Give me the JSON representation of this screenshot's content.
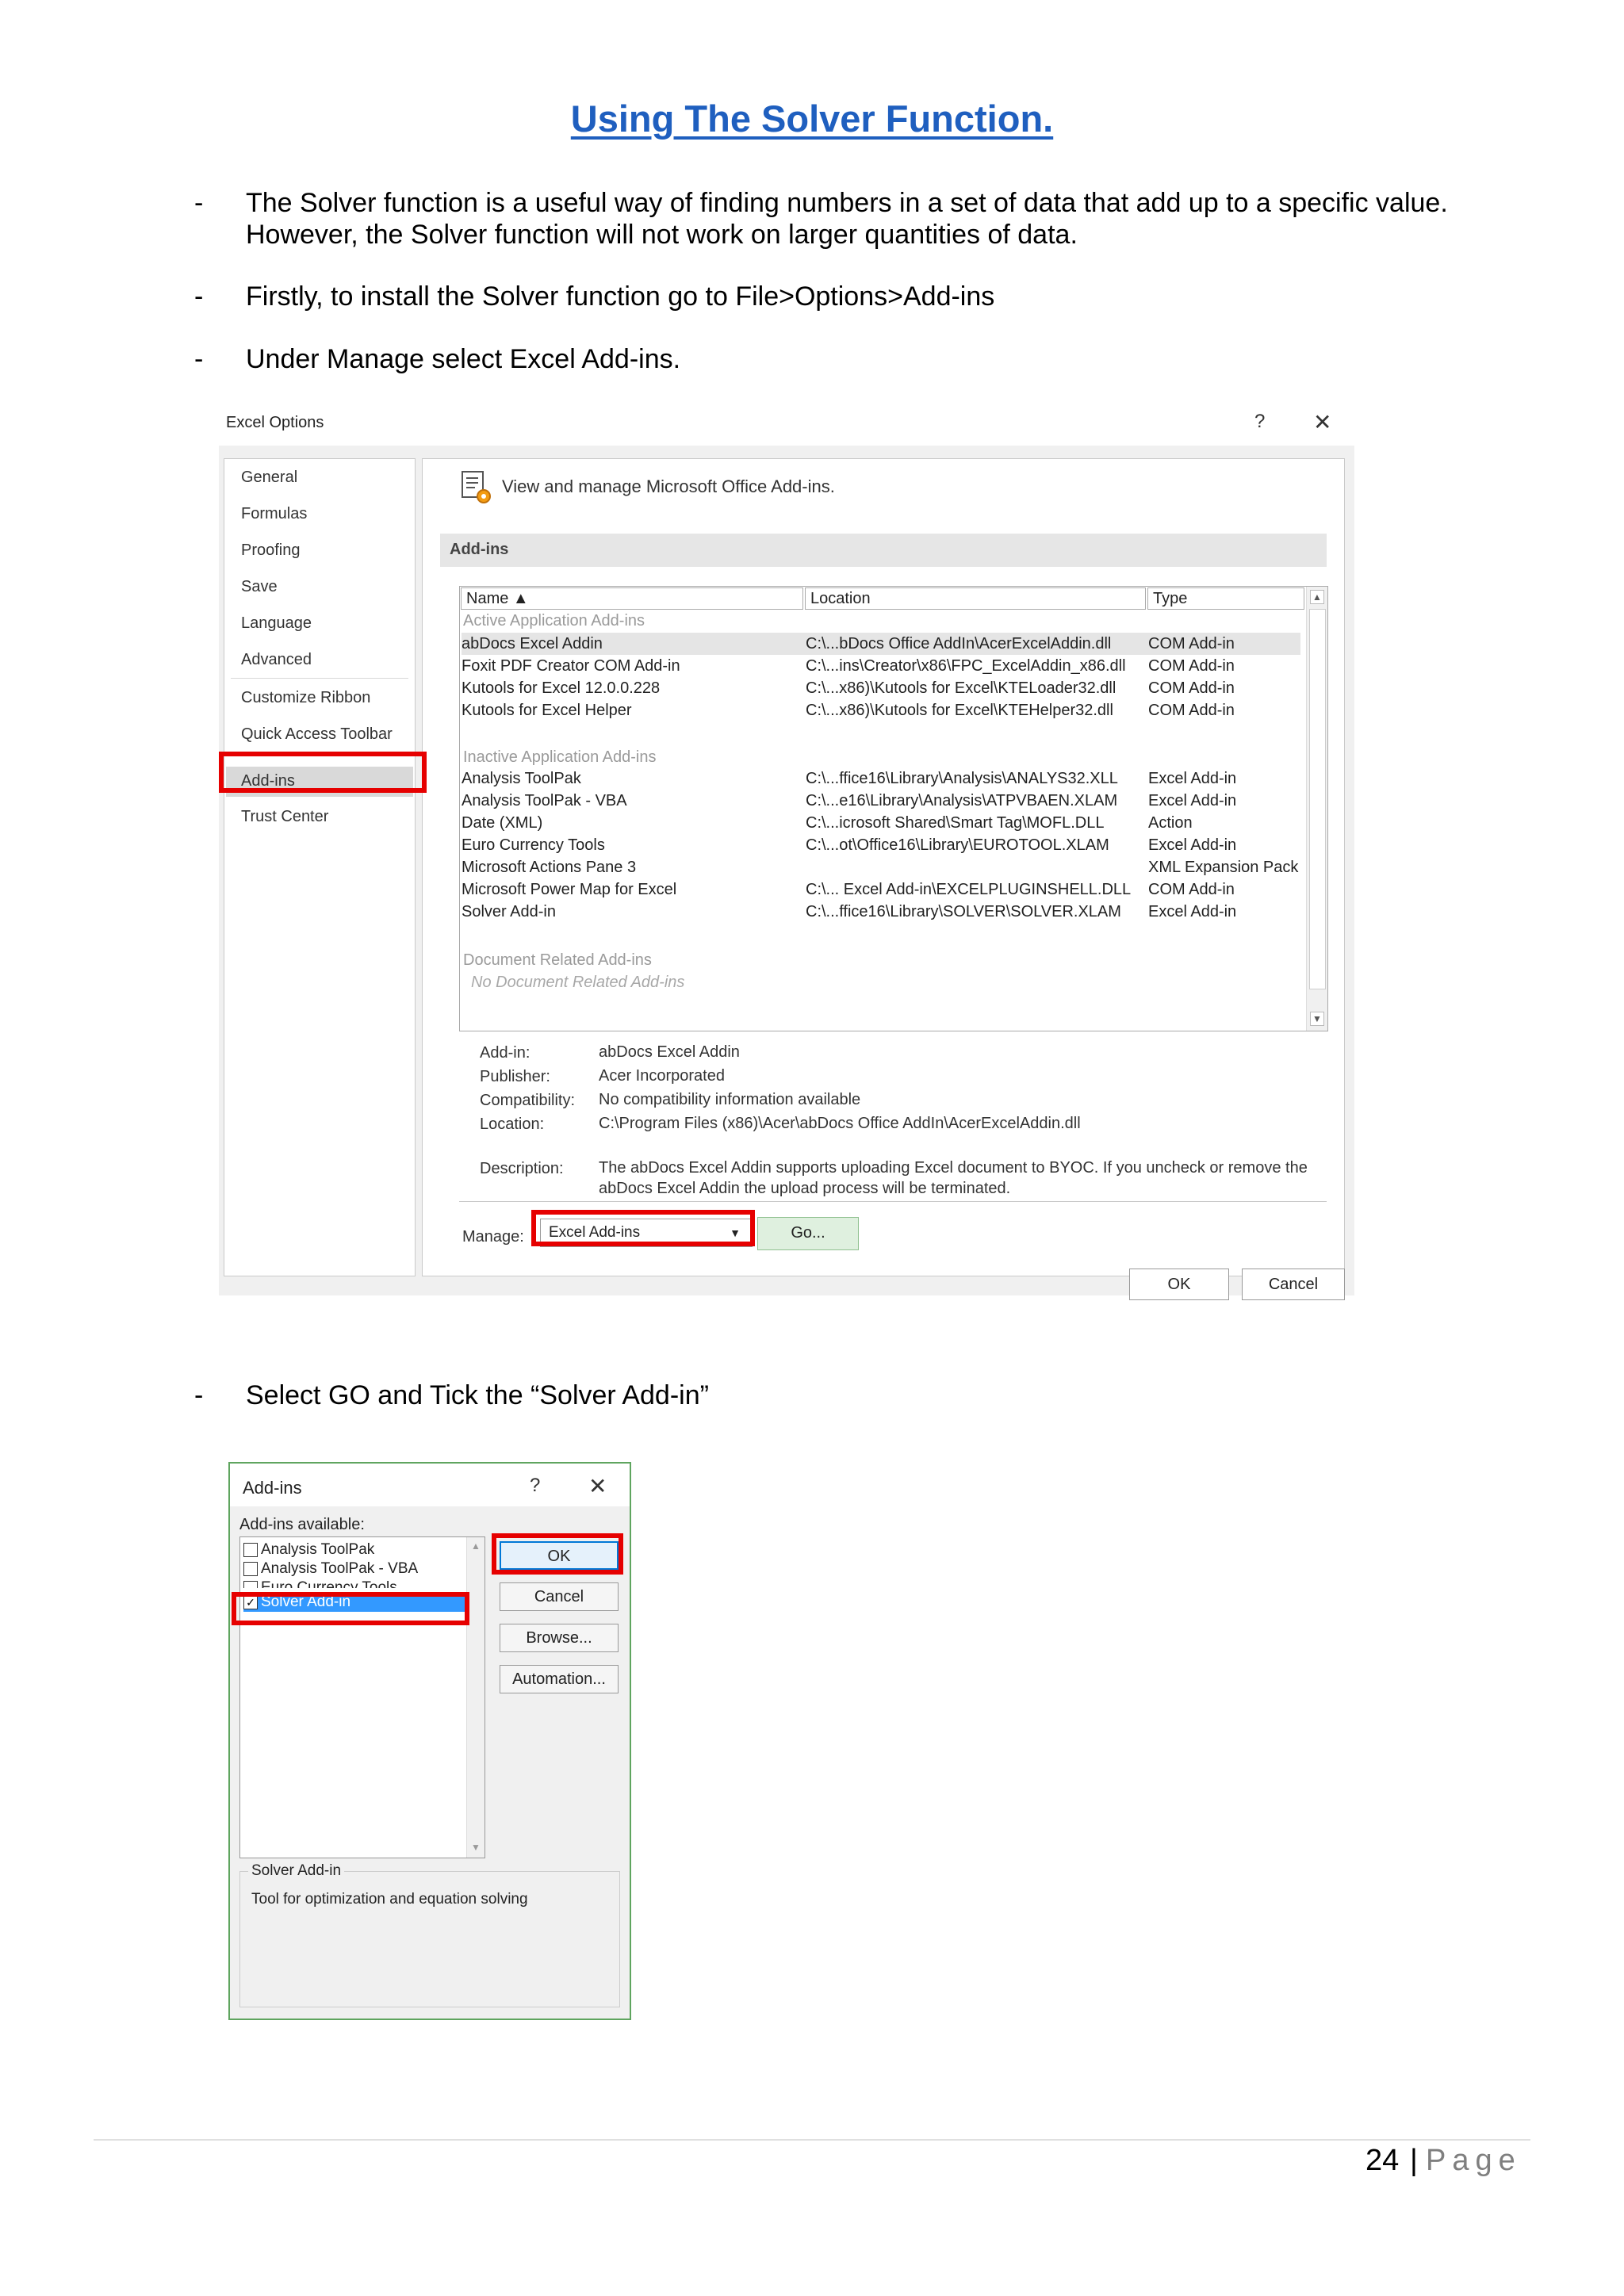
{
  "document": {
    "title": "Using The Solver Function.",
    "bullets": [
      {
        "marker": "-",
        "lines": [
          "The Solver function is a useful way of finding numbers in a set of data that add up to a specific value.",
          "However, the Solver function will not work on larger quantities of data."
        ]
      },
      {
        "marker": "-",
        "lines": [
          "Firstly, to install the Solver function go to File>Options>Add-ins"
        ]
      },
      {
        "marker": "-",
        "lines": [
          "Under Manage select Excel Add-ins."
        ]
      },
      {
        "marker": "-",
        "lines": [
          "Select GO and Tick the “Solver Add-in”"
        ]
      }
    ],
    "page_number": "24",
    "page_separator": "|",
    "page_word": "Page"
  },
  "excel_options": {
    "title": "Excel Options",
    "help": "?",
    "close": "✕",
    "nav": [
      "General",
      "Formulas",
      "Proofing",
      "Save",
      "Language",
      "Advanced",
      "Customize Ribbon",
      "Quick Access Toolbar",
      "Add-ins",
      "Trust Center"
    ],
    "header": "View and manage Microsoft Office Add-ins.",
    "section": "Add-ins",
    "columns": [
      "Name ▲",
      "Location",
      "Type"
    ],
    "groups": [
      {
        "label": "Active Application Add-ins",
        "rows": [
          {
            "name": "abDocs Excel Addin",
            "location": "C:\\...bDocs Office AddIn\\AcerExcelAddin.dll",
            "type": "COM Add-in"
          },
          {
            "name": "Foxit PDF Creator COM Add-in",
            "location": "C:\\...ins\\Creator\\x86\\FPC_ExcelAddin_x86.dll",
            "type": "COM Add-in"
          },
          {
            "name": "Kutools for Excel  12.0.0.228",
            "location": "C:\\...x86)\\Kutools for Excel\\KTELoader32.dll",
            "type": "COM Add-in"
          },
          {
            "name": "Kutools for Excel  Helper",
            "location": "C:\\...x86)\\Kutools for Excel\\KTEHelper32.dll",
            "type": "COM Add-in"
          }
        ]
      },
      {
        "label": "Inactive Application Add-ins",
        "rows": [
          {
            "name": "Analysis ToolPak",
            "location": "C:\\...ffice16\\Library\\Analysis\\ANALYS32.XLL",
            "type": "Excel Add-in"
          },
          {
            "name": "Analysis ToolPak - VBA",
            "location": "C:\\...e16\\Library\\Analysis\\ATPVBAEN.XLAM",
            "type": "Excel Add-in"
          },
          {
            "name": "Date (XML)",
            "location": "C:\\...icrosoft Shared\\Smart Tag\\MOFL.DLL",
            "type": "Action"
          },
          {
            "name": "Euro Currency Tools",
            "location": "C:\\...ot\\Office16\\Library\\EUROTOOL.XLAM",
            "type": "Excel Add-in"
          },
          {
            "name": "Microsoft Actions Pane 3",
            "location": "",
            "type": "XML Expansion Pack"
          },
          {
            "name": "Microsoft Power Map for Excel",
            "location": "C:\\... Excel Add-in\\EXCELPLUGINSHELL.DLL",
            "type": "COM Add-in"
          },
          {
            "name": "Solver Add-in",
            "location": "C:\\...ffice16\\Library\\SOLVER\\SOLVER.XLAM",
            "type": "Excel Add-in"
          }
        ]
      },
      {
        "label": "Document Related Add-ins",
        "empty": "No Document Related Add-ins"
      }
    ],
    "details": {
      "addin_label": "Add-in:",
      "addin": "abDocs Excel Addin",
      "publisher_label": "Publisher:",
      "publisher": "Acer Incorporated",
      "compat_label": "Compatibility:",
      "compat": "No compatibility information available",
      "location_label": "Location:",
      "location": "C:\\Program Files (x86)\\Acer\\abDocs Office AddIn\\AcerExcelAddin.dll",
      "desc_label": "Description:",
      "desc": "The abDocs Excel Addin supports uploading Excel document to BYOC. If you uncheck or remove the abDocs Excel Addin the upload process will be terminated."
    },
    "manage_label": "Manage:",
    "manage_value": "Excel Add-ins",
    "go_button": "Go...",
    "ok_button": "OK",
    "cancel_button": "Cancel"
  },
  "addins_dialog": {
    "title": "Add-ins",
    "help": "?",
    "close": "✕",
    "available_label": "Add-ins available:",
    "items": [
      {
        "label": "Analysis ToolPak",
        "checked": false
      },
      {
        "label": "Analysis ToolPak - VBA",
        "checked": false
      },
      {
        "label": "Euro Currency Tools",
        "checked": false
      },
      {
        "label": "Solver Add-in",
        "checked": true
      }
    ],
    "buttons": [
      "OK",
      "Cancel",
      "Browse...",
      "Automation..."
    ],
    "group_title": "Solver Add-in",
    "group_desc": "Tool for optimization and equation solving"
  },
  "colors": {
    "title_blue": "#1f5fbf",
    "highlight_red": "#e60000",
    "selection_blue": "#3399ff",
    "go_green": "#dff0df"
  }
}
